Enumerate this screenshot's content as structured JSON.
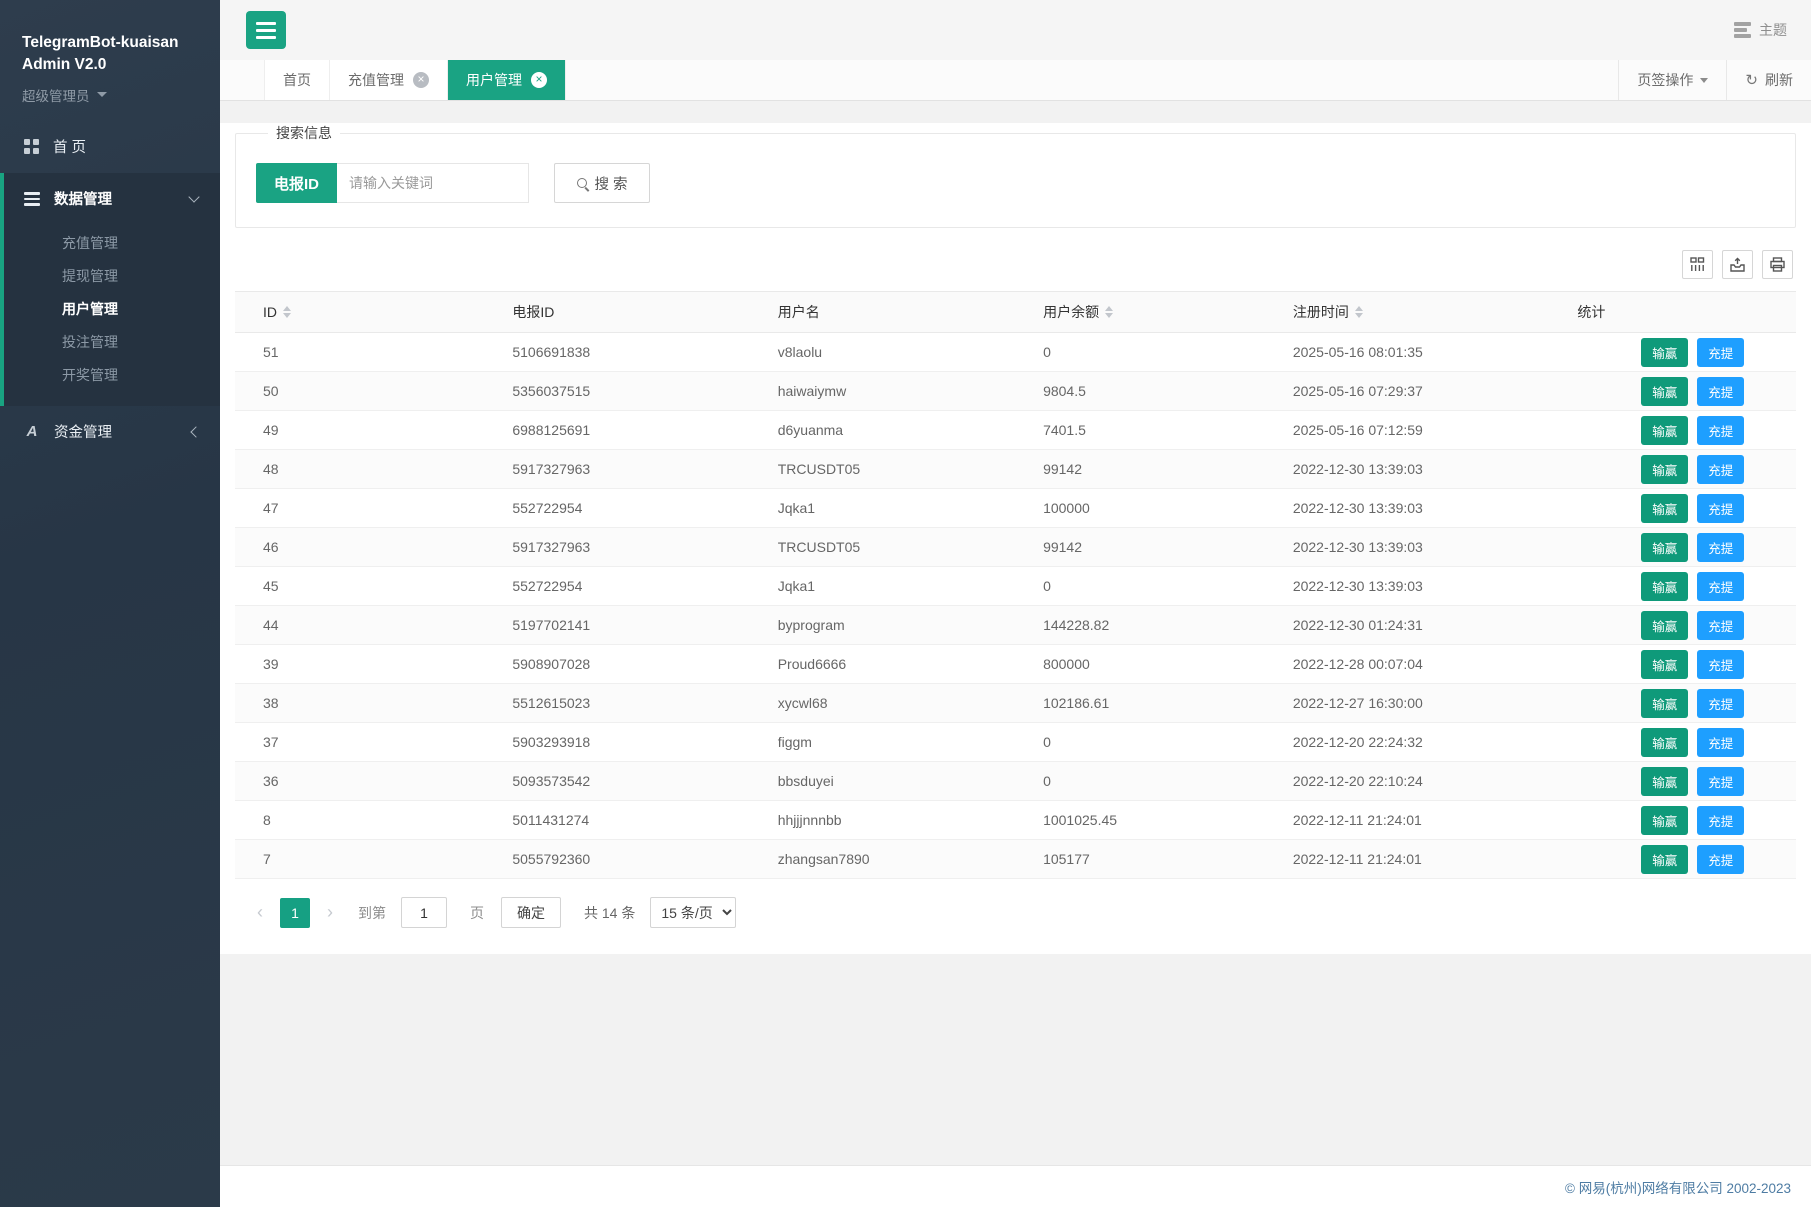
{
  "app": {
    "title_line1": "TelegramBot-kuaisan",
    "title_line2": "Admin V2.0",
    "role": "超级管理员",
    "theme_label": "主题"
  },
  "sidebar": {
    "home_label": "首 页",
    "data_section": {
      "label": "数据管理",
      "items": [
        {
          "label": "充值管理",
          "active": false
        },
        {
          "label": "提现管理",
          "active": false
        },
        {
          "label": "用户管理",
          "active": true
        },
        {
          "label": "投注管理",
          "active": false
        },
        {
          "label": "开奖管理",
          "active": false
        }
      ]
    },
    "funds_label": "资金管理",
    "funds_icon_glyph": "A"
  },
  "tabs": {
    "items": [
      {
        "label": "首页",
        "closable": false,
        "active": false
      },
      {
        "label": "充值管理",
        "closable": true,
        "active": false
      },
      {
        "label": "用户管理",
        "closable": true,
        "active": true
      }
    ],
    "actions_label": "页签操作",
    "refresh_icon": "↻",
    "refresh_label": "刷新"
  },
  "search": {
    "legend": "搜索信息",
    "field_button_label": "电报ID",
    "placeholder": "请输入关键词",
    "search_label": "搜 索"
  },
  "toolbar_icons": [
    "columns-icon",
    "export-icon",
    "print-icon"
  ],
  "table": {
    "columns": [
      "ID",
      "电报ID",
      "用户名",
      "用户余额",
      "注册时间",
      "统计"
    ],
    "labels": {
      "win": "输赢",
      "recharge": "充提"
    },
    "rows": [
      {
        "id": "51",
        "tg_id": "5106691838",
        "username": "v8laolu",
        "balance": "0",
        "reg_time": "2025-05-16 08:01:35"
      },
      {
        "id": "50",
        "tg_id": "5356037515",
        "username": "haiwaiymw",
        "balance": "9804.5",
        "reg_time": "2025-05-16 07:29:37"
      },
      {
        "id": "49",
        "tg_id": "6988125691",
        "username": "d6yuanma",
        "balance": "7401.5",
        "reg_time": "2025-05-16 07:12:59"
      },
      {
        "id": "48",
        "tg_id": "5917327963",
        "username": "TRCUSDT05",
        "balance": "99142",
        "reg_time": "2022-12-30 13:39:03"
      },
      {
        "id": "47",
        "tg_id": "552722954",
        "username": "Jqka1",
        "balance": "100000",
        "reg_time": "2022-12-30 13:39:03"
      },
      {
        "id": "46",
        "tg_id": "5917327963",
        "username": "TRCUSDT05",
        "balance": "99142",
        "reg_time": "2022-12-30 13:39:03"
      },
      {
        "id": "45",
        "tg_id": "552722954",
        "username": "Jqka1",
        "balance": "0",
        "reg_time": "2022-12-30 13:39:03"
      },
      {
        "id": "44",
        "tg_id": "5197702141",
        "username": "byprogram",
        "balance": "144228.82",
        "reg_time": "2022-12-30 01:24:31"
      },
      {
        "id": "39",
        "tg_id": "5908907028",
        "username": "Proud6666",
        "balance": "800000",
        "reg_time": "2022-12-28 00:07:04"
      },
      {
        "id": "38",
        "tg_id": "5512615023",
        "username": "xycwl68",
        "balance": "102186.61",
        "reg_time": "2022-12-27 16:30:00"
      },
      {
        "id": "37",
        "tg_id": "5903293918",
        "username": "figgm",
        "balance": "0",
        "reg_time": "2022-12-20 22:24:32"
      },
      {
        "id": "36",
        "tg_id": "5093573542",
        "username": "bbsduyei",
        "balance": "0",
        "reg_time": "2022-12-20 22:10:24"
      },
      {
        "id": "8",
        "tg_id": "5011431274",
        "username": "hhjjjnnnbb",
        "balance": "1001025.45",
        "reg_time": "2022-12-11 21:24:01"
      },
      {
        "id": "7",
        "tg_id": "5055792360",
        "username": "zhangsan7890",
        "balance": "105177",
        "reg_time": "2022-12-11 21:24:01"
      }
    ]
  },
  "pagination": {
    "current": "1",
    "goto_label": "到第",
    "goto_value": "1",
    "page_label": "页",
    "confirm_label": "确定",
    "total_label": "共 14 条",
    "per_page": "15 条/页"
  },
  "footer": {
    "copyright": "© 网易(杭州)网络有限公司 2002-2023"
  },
  "colors": {
    "green": "#1AA383",
    "win_green": "#0F9A7A",
    "blue": "#1E9FFF",
    "sidebar_bg": "#2B3A49",
    "active_section_bg": "#253240"
  }
}
